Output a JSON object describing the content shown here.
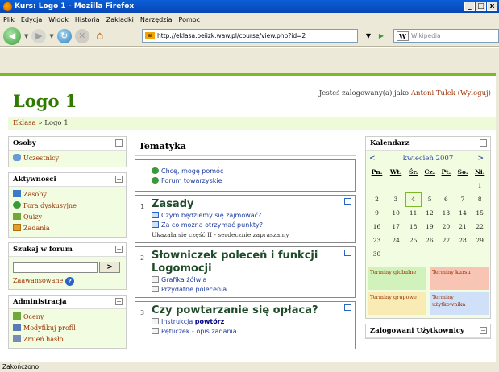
{
  "window": {
    "title": "Kurs: Logo 1 - Mozilla Firefox",
    "controls": [
      "_",
      "□",
      "x"
    ]
  },
  "menu": [
    "Plik",
    "Edycja",
    "Widok",
    "Historia",
    "Zakładki",
    "Narzędzia",
    "Pomoc"
  ],
  "nav": {
    "url": "http://eklasa.oeiizk.waw.pl/course/view.php?id=2",
    "search_engine": "W",
    "search_placeholder": "Wikipedia"
  },
  "header": {
    "logo": "Logo 1",
    "login_prefix": "Jesteś zalogowany(a) jako ",
    "login_user": "Antoni Tulek",
    "logout": "(Wyloguj)",
    "breadcrumb_root": "Eklasa",
    "breadcrumb_sep": " » ",
    "breadcrumb_current": "Logo 1"
  },
  "left": {
    "people": {
      "title": "Osoby",
      "items": [
        "Uczestnicy"
      ]
    },
    "activities": {
      "title": "Aktywności",
      "items": [
        "Zasoby",
        "Fora dyskusyjne",
        "Quizy",
        "Zadania"
      ]
    },
    "search": {
      "title": "Szukaj w forum",
      "button": ">",
      "advanced": "Zaawansowane"
    },
    "admin": {
      "title": "Administracja",
      "items": [
        "Oceny",
        "Modyfikuj profil",
        "Zmień hasło"
      ]
    }
  },
  "main": {
    "title": "Tematyka",
    "top_items": [
      "Chcę, mogę pomóc",
      "Forum towarzyskie"
    ],
    "topics": [
      {
        "num": "1",
        "title": "Zasady",
        "items": [
          "Czym będziemy się zajmować?",
          "Za co można otrzymać punkty?"
        ],
        "note": "Ukazała się część II - serdecznie zapraszamy"
      },
      {
        "num": "2",
        "title": "Słowniczek poleceń i funkcji Logomocji",
        "items": [
          "Grafika żółwia",
          "Przydatne polecenia"
        ]
      },
      {
        "num": "3",
        "title": "Czy powtarzanie się opłaca?",
        "items_rich": [
          {
            "pre": "Instrukcja ",
            "bold": "powtórz"
          }
        ],
        "items": [
          "Pętliczek - opis zadania"
        ]
      }
    ]
  },
  "right": {
    "calendar": {
      "title": "Kalendarz",
      "prev": "<",
      "month": "kwiecień 2007",
      "next": ">",
      "days": [
        "Pn.",
        "Wt.",
        "Śr.",
        "Cz.",
        "Pt.",
        "So.",
        "Ni."
      ],
      "weeks": [
        [
          "",
          "",
          "",
          "",
          "",
          "",
          "1"
        ],
        [
          "2",
          "3",
          "4",
          "5",
          "6",
          "7",
          "8"
        ],
        [
          "9",
          "10",
          "11",
          "12",
          "13",
          "14",
          "15"
        ],
        [
          "16",
          "17",
          "18",
          "19",
          "20",
          "21",
          "22"
        ],
        [
          "23",
          "24",
          "25",
          "26",
          "27",
          "28",
          "29"
        ],
        [
          "30",
          "",
          "",
          "",
          "",
          "",
          ""
        ]
      ],
      "today": "4",
      "legend": [
        "Terminy globalne",
        "Terminy kursu",
        "Terminy grupowe",
        "Terminy użytkownika"
      ]
    },
    "users_block_title": "Zalogowani Użytkownicy"
  },
  "status": "Zakończono"
}
